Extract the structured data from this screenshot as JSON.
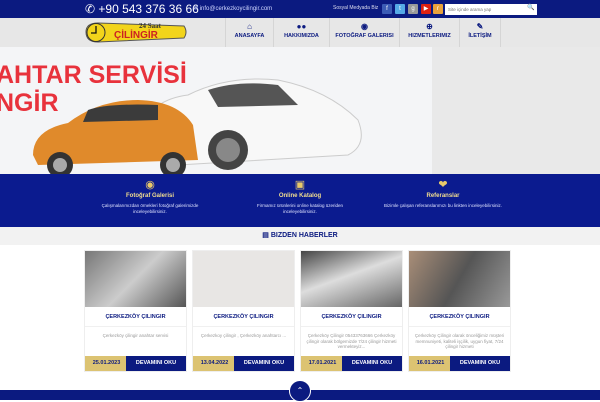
{
  "topbar": {
    "phone": "+90 543 376 36 66",
    "email": "info@cerkezkoycilingir.com",
    "social_label": "Sosyal Medyada Biz",
    "search_placeholder": "Site içinde arama yap"
  },
  "logo": {
    "line1": "24 Saat",
    "line2": "ÇİLİNGİR"
  },
  "nav": [
    {
      "label": "ANASAYFA",
      "icon": "home-icon"
    },
    {
      "label": "HAKKIMIZDA",
      "icon": "users-icon"
    },
    {
      "label": "FOTOĞRAF GALERISI",
      "icon": "camera-icon"
    },
    {
      "label": "HIZMETLERIMIZ",
      "icon": "plus-circle-icon"
    },
    {
      "label": "İLETİŞİM",
      "icon": "edit-icon"
    }
  ],
  "banner": {
    "line1": "AHTAR SERVİSİ",
    "line2": "NGİR"
  },
  "features": [
    {
      "title": "Fotoğraf Galerisi",
      "desc": "Çalışmalarımızdan örnekleri fotoğraf galerimizde inceleyebilirsiniz."
    },
    {
      "title": "Online Katalog",
      "desc": "Firmamız ürünlerini online katalog üzeriden inceleyebilirsiniz."
    },
    {
      "title": "Referanslar",
      "desc": "Bizimle çalışan referanslarımızı bu linkten inceleyebilirsiniz."
    }
  ],
  "section_title": "BIZDEN HABERLER",
  "cards": [
    {
      "title": "ÇERKEZKÖY ÇILINGIR",
      "text": "Çerkezköy çilingir anahtar servisi",
      "date": "25.01.2023",
      "button": "DEVAMINI OKU"
    },
    {
      "title": "ÇERKEZKÖY ÇILINGIR",
      "text": "Çerkezkoy çilingir , Çerkezköy anahtarcı ...",
      "date": "13.04.2022",
      "button": "DEVAMINI OKU"
    },
    {
      "title": "ÇERKEZKÖY ÇILINGIR",
      "text": "Çerkezköy Çilingir 05433763666 Çerkezköy çilingir olarak bölgemizde 7/24 çilingir hizmeti vermekteyiz...",
      "date": "17.01.2021",
      "button": "DEVAMINI OKU"
    },
    {
      "title": "ÇERKEZKÖY ÇILINGIR",
      "text": "Çerkezköy Çilingir olarak önceliğimiz müşteri memnuniyeti, kaliteli işçilik, uygun fiyat, 7/24 çilingir hizmeti",
      "date": "16.01.2021",
      "button": "DEVAMINI OKU"
    }
  ],
  "colors": {
    "navy": "#0b1a80",
    "gold": "#dcc372",
    "red": "#e8323c"
  }
}
